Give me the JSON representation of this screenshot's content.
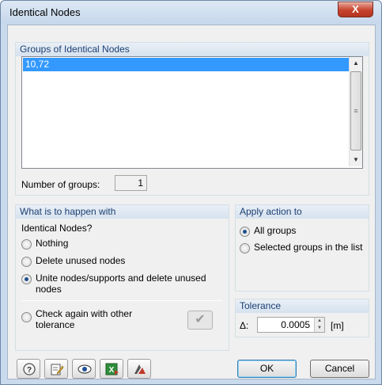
{
  "window": {
    "title": "Identical Nodes",
    "close_glyph": "X"
  },
  "groups_panel": {
    "header": "Groups of Identical Nodes",
    "items": [
      "10,72"
    ],
    "count_label": "Number of groups:",
    "count_value": "1"
  },
  "what_panel": {
    "header": "What is to happen with",
    "subheading": "Identical Nodes?",
    "options": [
      {
        "label": "Nothing",
        "checked": false
      },
      {
        "label": "Delete unused nodes",
        "checked": false
      },
      {
        "label": "Unite nodes/supports and delete unused nodes",
        "checked": true
      }
    ],
    "check_again_label": "Check again with other tolerance",
    "check_icon": "checkmark-icon"
  },
  "apply_panel": {
    "header": "Apply action to",
    "options": [
      {
        "label": "All groups",
        "checked": true
      },
      {
        "label": "Selected groups in the list",
        "checked": false
      }
    ]
  },
  "tolerance_panel": {
    "header": "Tolerance",
    "symbol": "Δ:",
    "value": "0.0005",
    "unit": "[m]"
  },
  "toolbar": {
    "icons": [
      "help-icon",
      "edit-icon",
      "view-icon",
      "excel-export-icon",
      "units-icon"
    ]
  },
  "buttons": {
    "ok": "OK",
    "cancel": "Cancel"
  },
  "colors": {
    "accent": "#3399ff",
    "panel_header_text": "#1b3f73",
    "window_frame": "#c9daed"
  }
}
